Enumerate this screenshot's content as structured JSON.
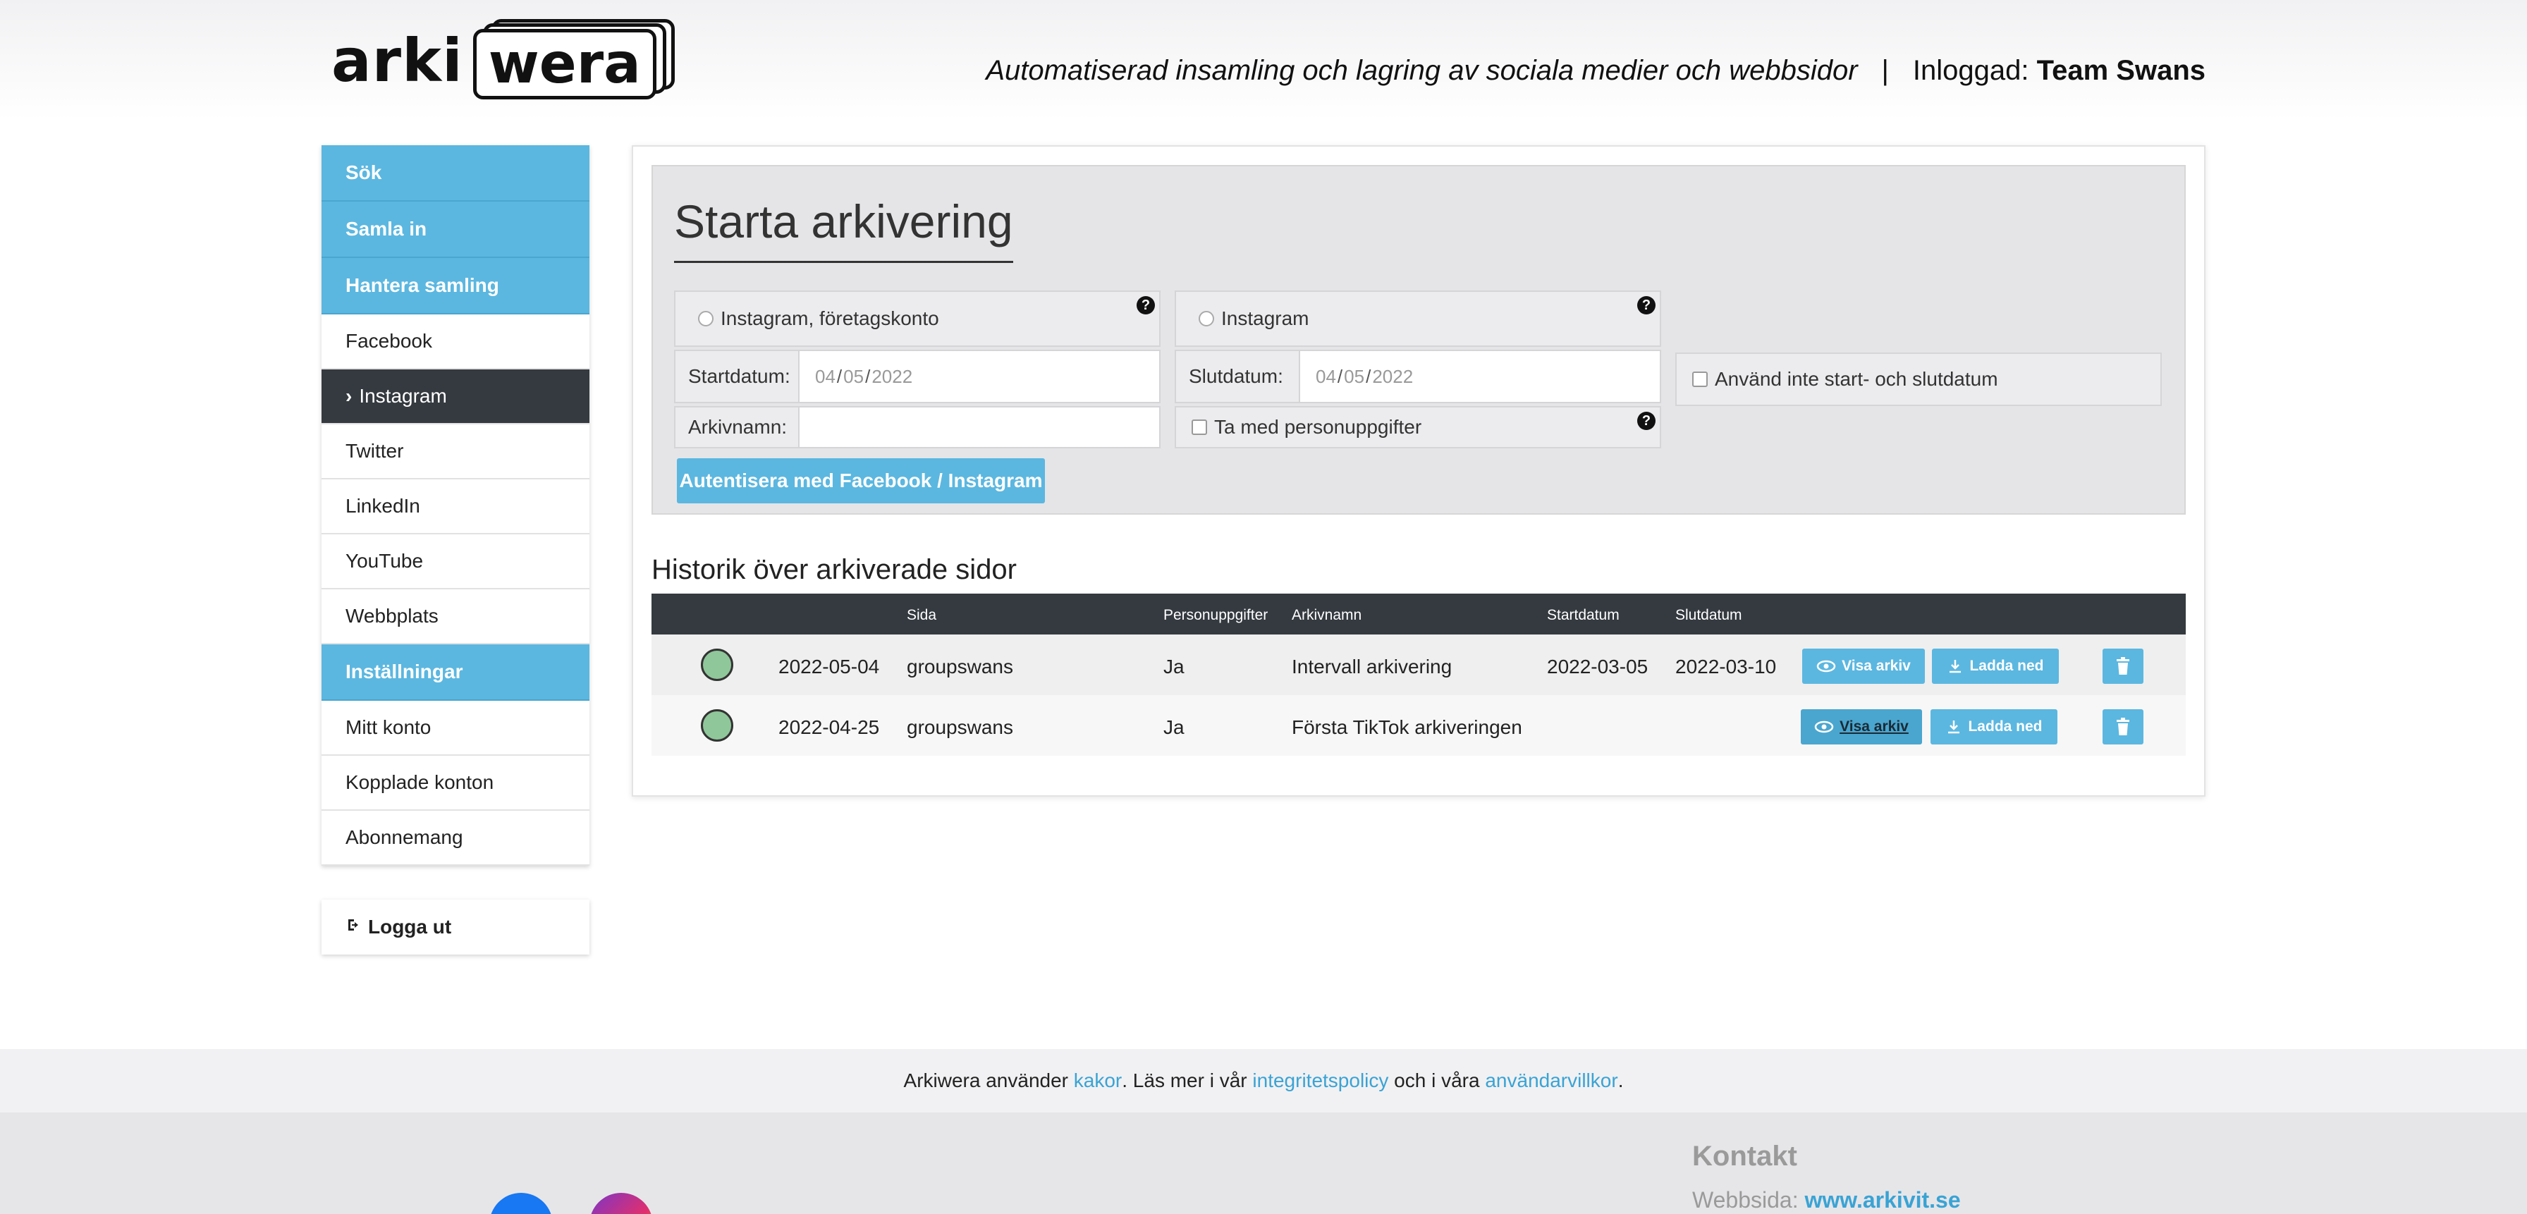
{
  "header": {
    "logo_left": "arki",
    "logo_right": "wera",
    "tagline": "Automatiserad insamling och lagring av sociala medier och webbsidor",
    "separator": "|",
    "logged_in_label": "Inloggad:",
    "logged_in_user": "Team Swans"
  },
  "sidebar": {
    "items": [
      {
        "label": "Sök"
      },
      {
        "label": "Samla in"
      },
      {
        "label": "Hantera samling"
      },
      {
        "label": "Facebook"
      },
      {
        "label": "Instagram"
      },
      {
        "label": "Twitter"
      },
      {
        "label": "LinkedIn"
      },
      {
        "label": "YouTube"
      },
      {
        "label": "Webbplats"
      },
      {
        "label": "Inställningar"
      },
      {
        "label": "Mitt konto"
      },
      {
        "label": "Kopplade konton"
      },
      {
        "label": "Abonnemang"
      }
    ],
    "logout": "Logga ut"
  },
  "start": {
    "title": "Starta arkivering",
    "radio_business": "Instagram, företagskonto",
    "radio_instagram": "Instagram",
    "start_label": "Startdatum:",
    "end_label": "Slutdatum:",
    "date_mm": "04",
    "date_dd": "05",
    "date_yyyy": "2022",
    "date_sep": "/",
    "no_dates_label": "Använd inte start- och slutdatum",
    "archive_name_label": "Arkivnamn:",
    "personal_data_label": "Ta med personuppgifter",
    "auth_button": "Autentisera med Facebook / Instagram",
    "help_glyph": "?"
  },
  "history": {
    "title": "Historik över arkiverade sidor",
    "columns": [
      "Sida",
      "Personuppgifter",
      "Arkivnamn",
      "Startdatum",
      "Slutdatum"
    ],
    "rows": [
      {
        "date": "2022-05-04",
        "page": "groupswans",
        "personal": "Ja",
        "name": "Intervall arkivering",
        "start": "2022-03-05",
        "end": "2022-03-10",
        "view": "Visa arkiv",
        "download": "Ladda ned"
      },
      {
        "date": "2022-04-25",
        "page": "groupswans",
        "personal": "Ja",
        "name": "Första TikTok arkiveringen",
        "start": "",
        "end": "",
        "view": "Visa arkiv",
        "download": "Ladda ned"
      }
    ]
  },
  "cookie": {
    "t1": "Arkiwera använder ",
    "l1": "kakor",
    "t2": ". Läs mer i vår ",
    "l2": "integritetspolicy",
    "t3": " och i våra ",
    "l3": "användarvillkor",
    "t4": "."
  },
  "footer": {
    "contact_title": "Kontakt",
    "web_label": "Webbsida: ",
    "web_link": "www.arkivit.se"
  },
  "colors": {
    "accent": "#5bb7e0",
    "dark": "#343a40",
    "status_green": "#8fc79a"
  }
}
